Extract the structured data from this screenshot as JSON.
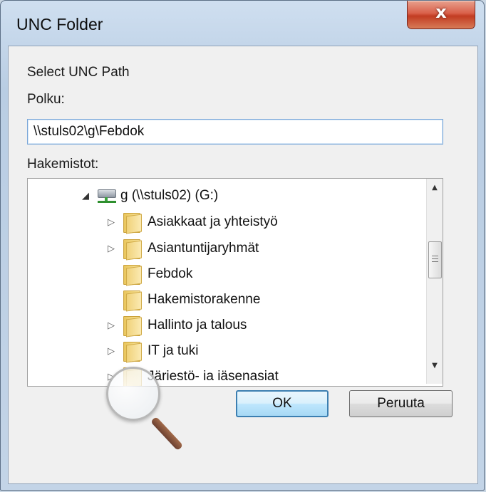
{
  "window": {
    "title": "UNC Folder",
    "close_label": "x"
  },
  "form": {
    "heading": "Select UNC Path",
    "path_label": "Polku:",
    "path_value": "\\\\stuls02\\g\\Febdok",
    "dirs_label": "Hakemistot:"
  },
  "tree": {
    "root": {
      "label": "g (\\\\stuls02) (G:)",
      "icon": "network-drive-icon",
      "expanded": true
    },
    "items": [
      {
        "label": "Asiakkaat ja yhteistyö",
        "has_children": true
      },
      {
        "label": "Asiantuntijaryhmät",
        "has_children": true
      },
      {
        "label": "Febdok",
        "has_children": false
      },
      {
        "label": "Hakemistorakenne",
        "has_children": false
      },
      {
        "label": "Hallinto ja talous",
        "has_children": true
      },
      {
        "label": "IT ja tuki",
        "has_children": true
      },
      {
        "label": "Järiestö- ia iäsenasiat",
        "has_children": true
      }
    ]
  },
  "buttons": {
    "ok": "OK",
    "cancel": "Peruuta"
  },
  "overlay": {
    "icon": "magnifier-icon"
  },
  "colors": {
    "accent": "#3c7fb1",
    "close": "#c23c22",
    "folder": "#e9c65c"
  }
}
